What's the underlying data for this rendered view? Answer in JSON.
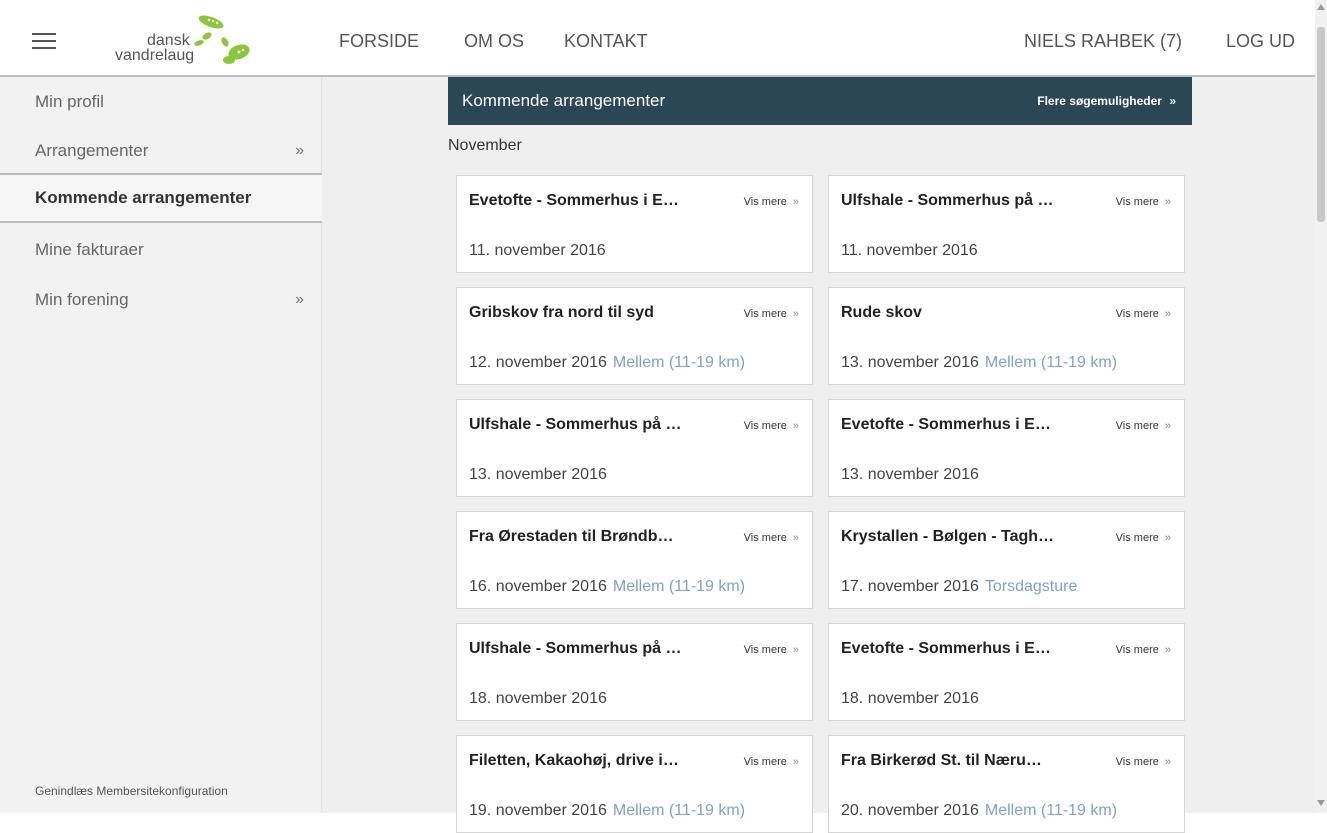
{
  "header": {
    "logo_line1": "dansk",
    "logo_line2": "vandrelaug",
    "nav": [
      "FORSIDE",
      "OM OS",
      "KONTAKT"
    ],
    "user": "NIELS RAHBEK (7)",
    "logout": "LOG UD"
  },
  "sidebar": {
    "items": [
      {
        "label": "Min profil",
        "chevron": ""
      },
      {
        "label": "Arrangementer",
        "chevron": "»"
      },
      {
        "label": "Kommende arrangementer",
        "chevron": ""
      },
      {
        "label": "Mine fakturaer",
        "chevron": ""
      },
      {
        "label": "Min forening",
        "chevron": "»"
      }
    ],
    "footer": "Genindlæs Membersitekonfiguration"
  },
  "main": {
    "title": "Kommende arrangementer",
    "more_label": "Flere søgemuligheder",
    "more_arrow": "»",
    "month": "November",
    "vis_mere": "Vis mere",
    "raquo": "»",
    "events": [
      {
        "title": "Evetofte - Sommerhus i E…",
        "date": "11. november 2016",
        "category": ""
      },
      {
        "title": "Ulfshale - Sommerhus på …",
        "date": "11. november 2016",
        "category": ""
      },
      {
        "title": "Gribskov fra nord til syd",
        "date": "12. november 2016",
        "category": "Mellem (11-19 km)"
      },
      {
        "title": "Rude skov",
        "date": "13. november 2016",
        "category": "Mellem (11-19 km)"
      },
      {
        "title": "Ulfshale - Sommerhus på …",
        "date": "13. november 2016",
        "category": ""
      },
      {
        "title": "Evetofte - Sommerhus i E…",
        "date": "13. november 2016",
        "category": ""
      },
      {
        "title": "Fra Ørestaden til Brøndb…",
        "date": "16. november 2016",
        "category": "Mellem (11-19 km)"
      },
      {
        "title": "Krystallen - Bølgen - Tagh…",
        "date": "17. november 2016",
        "category": "Torsdagsture"
      },
      {
        "title": "Ulfshale - Sommerhus på …",
        "date": "18. november 2016",
        "category": ""
      },
      {
        "title": "Evetofte - Sommerhus i E…",
        "date": "18. november 2016",
        "category": ""
      },
      {
        "title": "Filetten, Kakaohøj, drive i…",
        "date": "19. november 2016",
        "category": "Mellem (11-19 km)"
      },
      {
        "title": "Fra Birkerød St. til Næru…",
        "date": "20. november 2016",
        "category": "Mellem (11-19 km)"
      }
    ]
  },
  "colors": {
    "header_bar": "#2b4654",
    "category_link": "#7fa1c5",
    "logo_green": "#8cc63f"
  }
}
